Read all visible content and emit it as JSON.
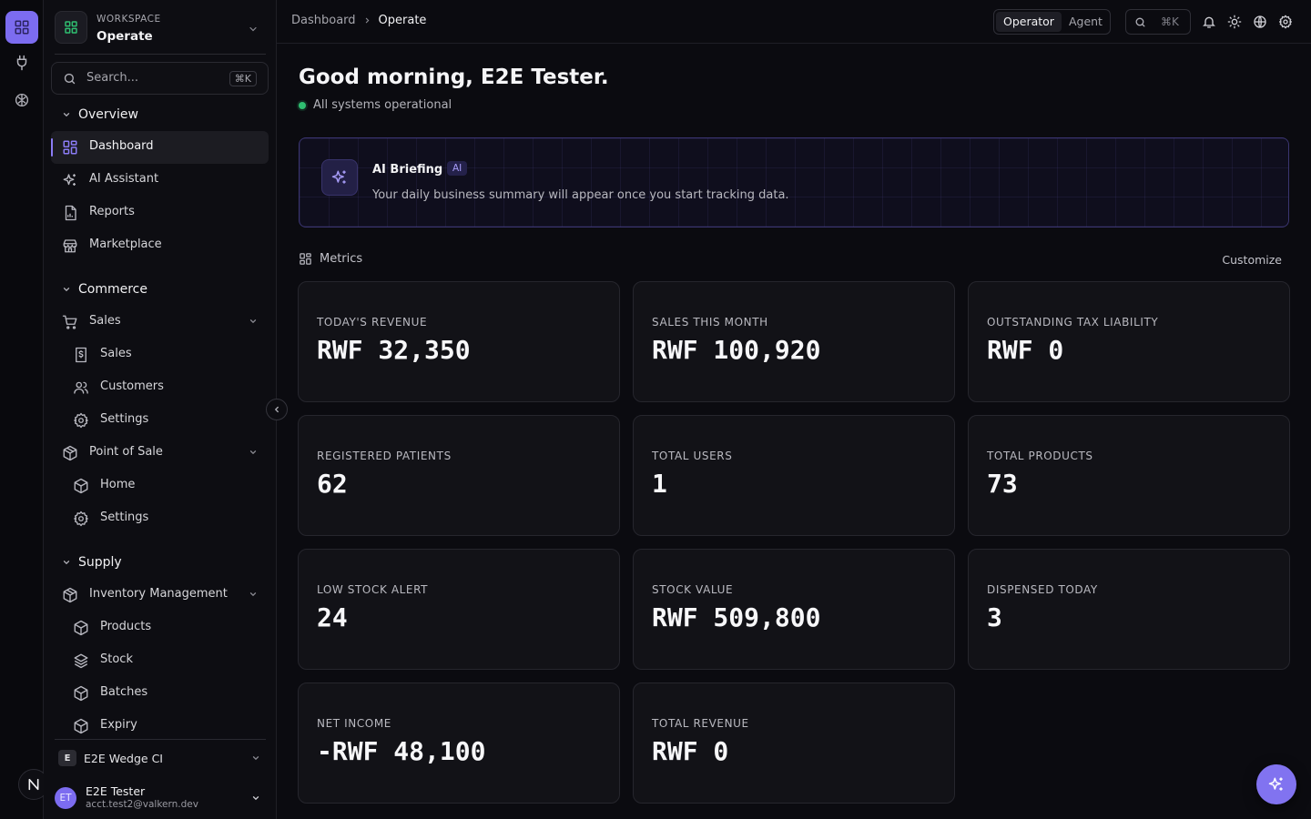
{
  "sidebar": {
    "workspace_label": "WORKSPACE",
    "workspace_name": "Operate",
    "search_placeholder": "Search...",
    "search_shortcut": "⌘K",
    "sections": {
      "overview": "Overview",
      "commerce": "Commerce",
      "supply": "Supply"
    },
    "items": {
      "dashboard": "Dashboard",
      "ai_assistant": "AI Assistant",
      "reports": "Reports",
      "marketplace": "Marketplace",
      "sales_group": "Sales",
      "sales": "Sales",
      "customers": "Customers",
      "sales_settings": "Settings",
      "pos_group": "Point of Sale",
      "pos_home": "Home",
      "pos_settings": "Settings",
      "inventory_group": "Inventory Management",
      "products": "Products",
      "stock": "Stock",
      "batches": "Batches",
      "expiry": "Expiry"
    },
    "org": {
      "badge": "E",
      "name": "E2E Wedge CI"
    },
    "user": {
      "initials": "ET",
      "name": "E2E Tester",
      "email": "acct.test2@valkern.dev"
    }
  },
  "topbar": {
    "breadcrumb": [
      "Dashboard",
      "Operate"
    ],
    "modes": [
      "Operator",
      "Agent"
    ],
    "active_mode": "Operator",
    "search_shortcut": "⌘K"
  },
  "main": {
    "greeting": "Good morning, E2E Tester.",
    "status": "All systems operational",
    "briefing": {
      "title": "AI Briefing",
      "tag": "AI",
      "text": "Your daily business summary will appear once you start tracking data."
    },
    "metrics_title": "Metrics",
    "customize_label": "Customize",
    "metrics": [
      {
        "label": "TODAY'S REVENUE",
        "value": "RWF 32,350"
      },
      {
        "label": "SALES THIS MONTH",
        "value": "RWF 100,920"
      },
      {
        "label": "OUTSTANDING TAX LIABILITY",
        "value": "RWF 0"
      },
      {
        "label": "REGISTERED PATIENTS",
        "value": "62"
      },
      {
        "label": "TOTAL USERS",
        "value": "1"
      },
      {
        "label": "TOTAL PRODUCTS",
        "value": "73"
      },
      {
        "label": "LOW STOCK ALERT",
        "value": "24"
      },
      {
        "label": "STOCK VALUE",
        "value": "RWF 509,800"
      },
      {
        "label": "DISPENSED TODAY",
        "value": "3"
      },
      {
        "label": "NET INCOME",
        "value": "-RWF 48,100"
      },
      {
        "label": "TOTAL REVENUE",
        "value": "RWF 0"
      }
    ]
  },
  "colors": {
    "accent": "#7c6cf0",
    "status_ok": "#2fbf71",
    "background": "#0b0b10",
    "card": "#121217"
  }
}
